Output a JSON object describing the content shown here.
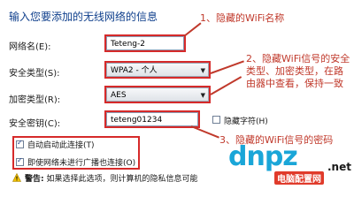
{
  "header": {
    "title": "输入您要添加的无线网络的信息"
  },
  "form": {
    "network_name": {
      "label": "网络名(E):",
      "value": "Teteng-2"
    },
    "security_type": {
      "label": "安全类型(S):",
      "value": "WPA2 - 个人"
    },
    "encryption_type": {
      "label": "加密类型(R):",
      "value": "AES"
    },
    "security_key": {
      "label": "安全密钥(C):",
      "value": "teteng01234"
    },
    "hide_chars": {
      "label": "隐藏字符(H)",
      "checked": false
    }
  },
  "options": {
    "auto_connect": {
      "label": "自动启动此连接(T)",
      "checked": true
    },
    "connect_unbroadcast": {
      "label": "即使网络未进行广播也连接(O)",
      "checked": true
    }
  },
  "warning": {
    "prefix": "警告:",
    "text": "如果选择此选项，则计算机的隐私信息可能"
  },
  "annotations": {
    "note1": "1、隐藏的WiFi名称",
    "note2": "2、隐藏WiFi信号的安全类型、加密类型，在路由器中查看，保持一致",
    "note3": "3、隐藏的WiFi信号的密码"
  },
  "watermark": {
    "logo": "dnpz",
    "domain": ".net",
    "tagline": "电脑配置网"
  },
  "colors": {
    "annotation_red": "#c0392b",
    "header_blue": "#0f3f8c",
    "watermark_blue": "#1aa6d8"
  }
}
